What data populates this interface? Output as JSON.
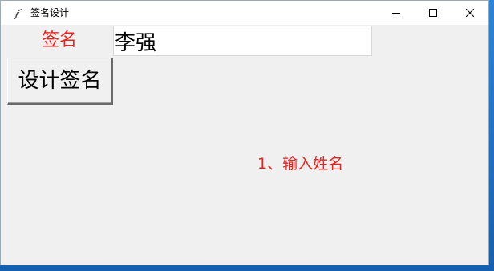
{
  "window": {
    "title": "签名设计",
    "icon": "feather-icon"
  },
  "form": {
    "sign_label": "签名",
    "name_value": "李强",
    "design_button_label": "设计签名",
    "hint": "1、输入姓名"
  },
  "colors": {
    "accent_text": "#e8231f",
    "window_bg": "#f0f0f0",
    "input_bg": "#ffffff"
  }
}
